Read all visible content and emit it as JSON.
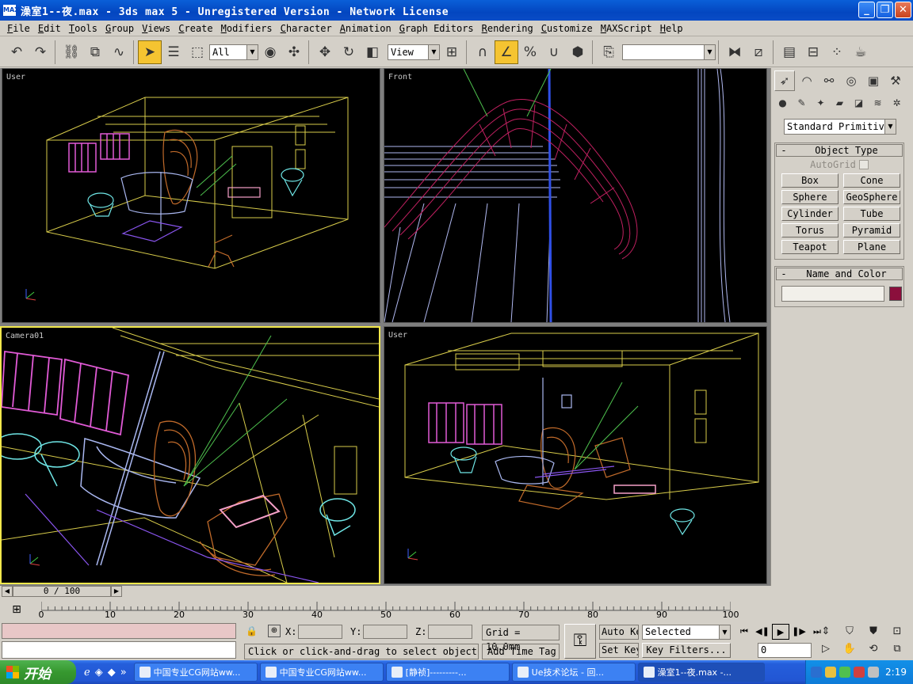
{
  "window": {
    "icon_text": "MAX",
    "title": "澡室1--夜.max - 3ds max 5 - Unregistered Version - Network License",
    "btn_min": "_",
    "btn_max": "❐",
    "btn_close": "✕"
  },
  "menu": [
    "File",
    "Edit",
    "Tools",
    "Group",
    "Views",
    "Create",
    "Modifiers",
    "Character",
    "Animation",
    "Graph Editors",
    "Rendering",
    "Customize",
    "MAXScript",
    "Help"
  ],
  "toolbar": {
    "selection_filter": "All",
    "reference_coord": "View",
    "named_selection": ""
  },
  "viewports": {
    "top_left": "User",
    "top_right": "Front",
    "bottom_left": "Camera01",
    "bottom_right": "User"
  },
  "command_panel": {
    "category": "Standard Primitiv",
    "object_type_title": "Object Type",
    "autogrid": "AutoGrid",
    "buttons": [
      "Box",
      "Cone",
      "Sphere",
      "GeoSphere",
      "Cylinder",
      "Tube",
      "Torus",
      "Pyramid",
      "Teapot",
      "Plane"
    ],
    "name_color_title": "Name and Color",
    "rollout_toggle": "-",
    "color_swatch": "#8b0f3c"
  },
  "timeline": {
    "frame": "0 / 100",
    "ticks": [
      "0",
      "10",
      "20",
      "30",
      "40",
      "50",
      "60",
      "70",
      "80",
      "90",
      "100"
    ]
  },
  "status": {
    "x_label": "X:",
    "y_label": "Y:",
    "z_label": "Z:",
    "grid": "Grid = 10.0mm",
    "prompt": "Click or click-and-drag to select objects",
    "add_time_tag": "Add Time Tag",
    "auto_key": "Auto Key",
    "set_key": "Set Key",
    "key_mode": "Selected",
    "key_filters": "Key Filters...",
    "current_frame": "0"
  },
  "taskbar": {
    "start": "开始",
    "tasks": [
      "中国专业CG网站ww...",
      "中国专业CG网站ww...",
      "[静祯]---------...",
      "Ue技术论坛 - 回...",
      "澡室1--夜.max -..."
    ],
    "clock": "2:19"
  }
}
